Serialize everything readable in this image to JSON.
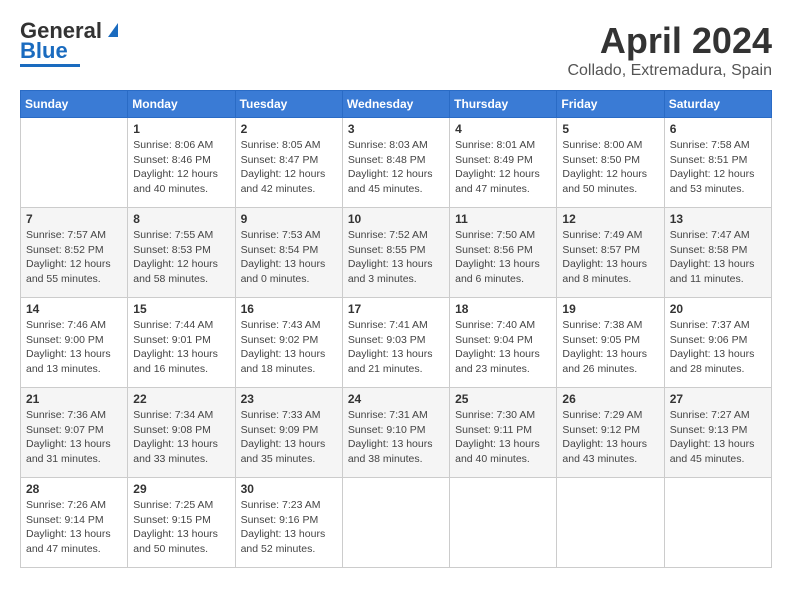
{
  "header": {
    "logo_general": "General",
    "logo_blue": "Blue",
    "title": "April 2024",
    "subtitle": "Collado, Extremadura, Spain"
  },
  "calendar": {
    "days_of_week": [
      "Sunday",
      "Monday",
      "Tuesday",
      "Wednesday",
      "Thursday",
      "Friday",
      "Saturday"
    ],
    "weeks": [
      [
        {
          "day": "",
          "info": ""
        },
        {
          "day": "1",
          "info": "Sunrise: 8:06 AM\nSunset: 8:46 PM\nDaylight: 12 hours\nand 40 minutes."
        },
        {
          "day": "2",
          "info": "Sunrise: 8:05 AM\nSunset: 8:47 PM\nDaylight: 12 hours\nand 42 minutes."
        },
        {
          "day": "3",
          "info": "Sunrise: 8:03 AM\nSunset: 8:48 PM\nDaylight: 12 hours\nand 45 minutes."
        },
        {
          "day": "4",
          "info": "Sunrise: 8:01 AM\nSunset: 8:49 PM\nDaylight: 12 hours\nand 47 minutes."
        },
        {
          "day": "5",
          "info": "Sunrise: 8:00 AM\nSunset: 8:50 PM\nDaylight: 12 hours\nand 50 minutes."
        },
        {
          "day": "6",
          "info": "Sunrise: 7:58 AM\nSunset: 8:51 PM\nDaylight: 12 hours\nand 53 minutes."
        }
      ],
      [
        {
          "day": "7",
          "info": "Sunrise: 7:57 AM\nSunset: 8:52 PM\nDaylight: 12 hours\nand 55 minutes."
        },
        {
          "day": "8",
          "info": "Sunrise: 7:55 AM\nSunset: 8:53 PM\nDaylight: 12 hours\nand 58 minutes."
        },
        {
          "day": "9",
          "info": "Sunrise: 7:53 AM\nSunset: 8:54 PM\nDaylight: 13 hours\nand 0 minutes."
        },
        {
          "day": "10",
          "info": "Sunrise: 7:52 AM\nSunset: 8:55 PM\nDaylight: 13 hours\nand 3 minutes."
        },
        {
          "day": "11",
          "info": "Sunrise: 7:50 AM\nSunset: 8:56 PM\nDaylight: 13 hours\nand 6 minutes."
        },
        {
          "day": "12",
          "info": "Sunrise: 7:49 AM\nSunset: 8:57 PM\nDaylight: 13 hours\nand 8 minutes."
        },
        {
          "day": "13",
          "info": "Sunrise: 7:47 AM\nSunset: 8:58 PM\nDaylight: 13 hours\nand 11 minutes."
        }
      ],
      [
        {
          "day": "14",
          "info": "Sunrise: 7:46 AM\nSunset: 9:00 PM\nDaylight: 13 hours\nand 13 minutes."
        },
        {
          "day": "15",
          "info": "Sunrise: 7:44 AM\nSunset: 9:01 PM\nDaylight: 13 hours\nand 16 minutes."
        },
        {
          "day": "16",
          "info": "Sunrise: 7:43 AM\nSunset: 9:02 PM\nDaylight: 13 hours\nand 18 minutes."
        },
        {
          "day": "17",
          "info": "Sunrise: 7:41 AM\nSunset: 9:03 PM\nDaylight: 13 hours\nand 21 minutes."
        },
        {
          "day": "18",
          "info": "Sunrise: 7:40 AM\nSunset: 9:04 PM\nDaylight: 13 hours\nand 23 minutes."
        },
        {
          "day": "19",
          "info": "Sunrise: 7:38 AM\nSunset: 9:05 PM\nDaylight: 13 hours\nand 26 minutes."
        },
        {
          "day": "20",
          "info": "Sunrise: 7:37 AM\nSunset: 9:06 PM\nDaylight: 13 hours\nand 28 minutes."
        }
      ],
      [
        {
          "day": "21",
          "info": "Sunrise: 7:36 AM\nSunset: 9:07 PM\nDaylight: 13 hours\nand 31 minutes."
        },
        {
          "day": "22",
          "info": "Sunrise: 7:34 AM\nSunset: 9:08 PM\nDaylight: 13 hours\nand 33 minutes."
        },
        {
          "day": "23",
          "info": "Sunrise: 7:33 AM\nSunset: 9:09 PM\nDaylight: 13 hours\nand 35 minutes."
        },
        {
          "day": "24",
          "info": "Sunrise: 7:31 AM\nSunset: 9:10 PM\nDaylight: 13 hours\nand 38 minutes."
        },
        {
          "day": "25",
          "info": "Sunrise: 7:30 AM\nSunset: 9:11 PM\nDaylight: 13 hours\nand 40 minutes."
        },
        {
          "day": "26",
          "info": "Sunrise: 7:29 AM\nSunset: 9:12 PM\nDaylight: 13 hours\nand 43 minutes."
        },
        {
          "day": "27",
          "info": "Sunrise: 7:27 AM\nSunset: 9:13 PM\nDaylight: 13 hours\nand 45 minutes."
        }
      ],
      [
        {
          "day": "28",
          "info": "Sunrise: 7:26 AM\nSunset: 9:14 PM\nDaylight: 13 hours\nand 47 minutes."
        },
        {
          "day": "29",
          "info": "Sunrise: 7:25 AM\nSunset: 9:15 PM\nDaylight: 13 hours\nand 50 minutes."
        },
        {
          "day": "30",
          "info": "Sunrise: 7:23 AM\nSunset: 9:16 PM\nDaylight: 13 hours\nand 52 minutes."
        },
        {
          "day": "",
          "info": ""
        },
        {
          "day": "",
          "info": ""
        },
        {
          "day": "",
          "info": ""
        },
        {
          "day": "",
          "info": ""
        }
      ]
    ]
  }
}
